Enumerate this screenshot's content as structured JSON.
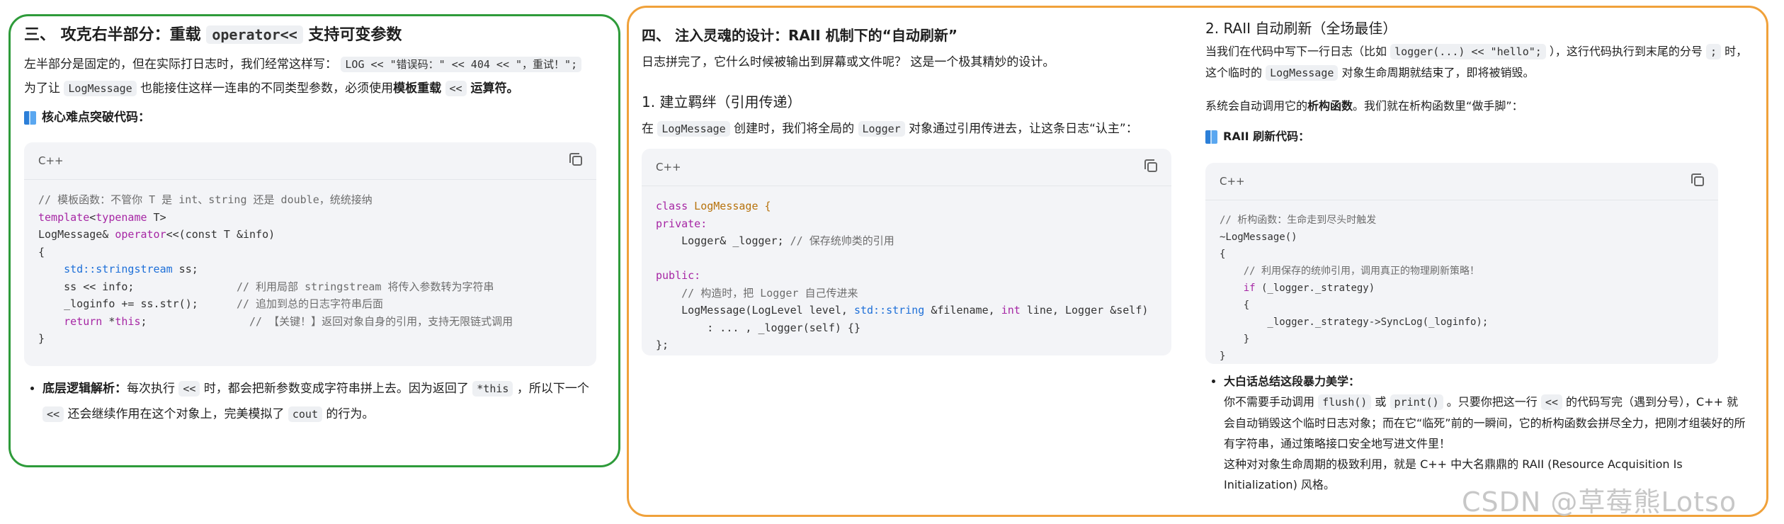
{
  "left": {
    "title_a": "三、 攻克右半部分：重载 ",
    "title_code": "operator<<",
    "title_b": " 支持可变参数",
    "p1_a": "左半部分是固定的，但在实际打日志时，我们经常这样写：",
    "p1_code": "LOG << \"错误码：\" << 404 << \"，重试！\";",
    "p2_a": "为了让 ",
    "p2_code1": "LogMessage",
    "p2_b": " 也能接住这样一连串的不同类型参数，必须使用",
    "p2_bold": "模板重载",
    "p2_code2": "<<",
    "p2_c": " 运算符。",
    "section_label": "核心难点突破代码：",
    "code_lang": "C++",
    "code": {
      "l1": "// 模板函数：不管你 T 是 int、string 还是 double，统统接纳",
      "l2_kw": "template",
      "l2_b": "<",
      "l2_kw2": "typename",
      "l2_c": " T>",
      "l3_a": "LogMessage& ",
      "l3_kw": "operator",
      "l3_b": "<<(const T &info)",
      "l4": "{",
      "l5_ns": "std::stringstream",
      "l5_b": " ss;",
      "l6_a": "ss << info;",
      "l6_cm": "// 利用局部 stringstream 将传入参数转为字符串",
      "l7_a": "_loginfo += ss.str();",
      "l7_cm": "// 追加到总的日志字符串后面",
      "l8_kw": "return",
      "l8_b": " *",
      "l8_kw2": "this",
      "l8_c": ";",
      "l8_cm": "// 【关键！】返回对象自身的引用，支持无限链式调用",
      "l9": "}"
    },
    "bullet_bold": "底层逻辑解析：",
    "bullet_a": "每次执行 ",
    "bullet_code1": "<<",
    "bullet_b": " 时，都会把新参数变成字符串拼上去。因为返回了 ",
    "bullet_code2": "*this",
    "bullet_c": " ，所以下一个 ",
    "bullet_code3": "<<",
    "bullet_d": " 还会继续作用在这个对象上，完美模拟了 ",
    "bullet_code4": "cout",
    "bullet_e": " 的行为。"
  },
  "middle": {
    "title": "四、 注入灵魂的设计：RAII 机制下的“自动刷新”",
    "intro": "日志拼完了，它什么时候被输出到屏幕或文件呢？ 这是一个极其精妙的设计。",
    "h1": "1. 建立羁绊（引用传递）",
    "p_a": "在 ",
    "p_code1": "LogMessage",
    "p_b": " 创建时，我们将全局的 ",
    "p_code2": "Logger",
    "p_c": " 对象通过引用传进去，让这条日志“认主”：",
    "code_lang": "C++",
    "code": {
      "l1_kw": "class",
      "l1_ty": " LogMessage",
      "l1_b": " {",
      "l2_kw": "private:",
      "l3_a": "    Logger& _logger; ",
      "l3_cm": "// 保存统帅类的引用",
      "l4": "",
      "l5_kw": "public:",
      "l6_cm": "    // 构造时，把 Logger 自己传进来",
      "l7_a": "    LogMessage(LogLevel level, ",
      "l7_ns": "std::string",
      "l7_b": " &filename, ",
      "l7_kw": "int",
      "l7_c": " line, Logger &self)",
      "l8": "        : ... , _logger(self) {}",
      "l9": "};"
    }
  },
  "right": {
    "h2": "2. RAII 自动刷新（全场最佳）",
    "p1_a": "当我们在代码中写下一行日志（比如 ",
    "p1_code1": "logger(...) << \"hello\";",
    "p1_b": " ），这行代码执行到末尾的分号 ",
    "p1_code2": ";",
    "p1_c": " 时，这个临时的 ",
    "p1_code3": "LogMessage",
    "p1_d": " 对象生命周期就结束了，即将被销毁。",
    "p2_a": "系统会自动调用它的",
    "p2_bold": "析构函数",
    "p2_b": "。我们就在析构函数里“做手脚”：",
    "section_label": "RAII 刷新代码：",
    "code_lang": "C++",
    "code": {
      "l1": "// 析构函数：生命走到尽头时触发",
      "l2": "~LogMessage()",
      "l3": "{",
      "l4": "    // 利用保存的统帅引用，调用真正的物理刷新策略！",
      "l5_a": "    ",
      "l5_kw": "if",
      "l5_b": " (_logger._strategy)",
      "l6": "    {",
      "l7": "        _logger._strategy->SyncLog(_loginfo);",
      "l8": "    }",
      "l9": "}"
    },
    "bullet_bold": "大白话总结这段暴力美学：",
    "b1_a": "你不需要手动调用 ",
    "b1_code1": "flush()",
    "b1_b": " 或 ",
    "b1_code2": "print()",
    "b1_c": " 。只要你把这一行 ",
    "b1_code3": "<<",
    "b1_d": " 的代码写完（遇到分号），C++ 就会自动销毁这个临时日志对象；而在它“临死”前的一瞬间，它的析构函数会拼尽全力，把刚才组装好的所有字符串，通过策略接口安全地写进文件里！",
    "b2": "这种对对象生命周期的极致利用，就是 C++ 中大名鼎鼎的 RAII (Resource Acquisition Is Initialization) 风格。"
  },
  "watermark": "CSDN @草莓熊Lotso",
  "colors": {
    "left_border": "#2e9b3a",
    "right_border": "#f0a13a"
  }
}
